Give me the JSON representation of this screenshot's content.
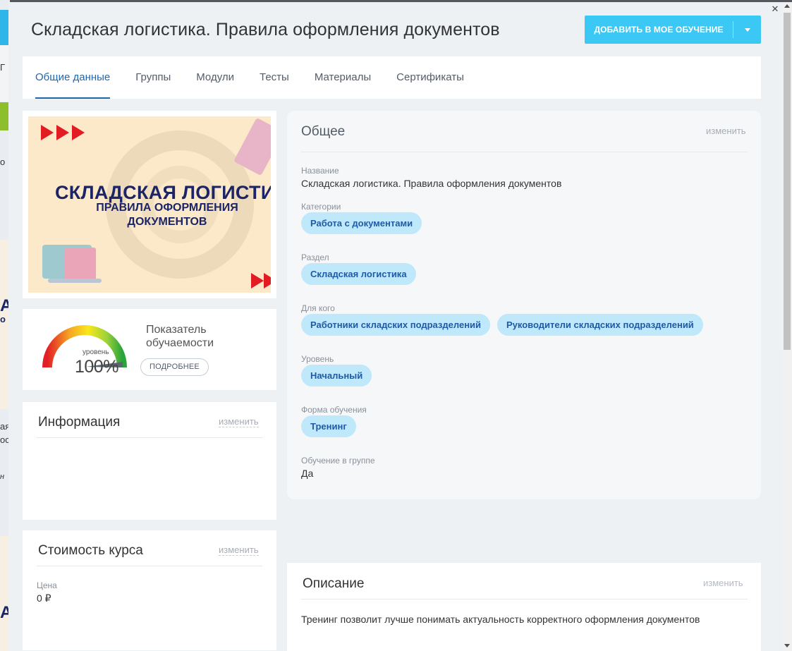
{
  "background": {
    "snippets": [
      "Г",
      "о",
      "А",
      "о",
      "ая",
      "ос",
      "н",
      "А"
    ]
  },
  "header": {
    "title": "Складская логистика. Правила оформления документов",
    "add_button_label": "ДОБАВИТЬ В МОЕ ОБУЧЕНИЕ"
  },
  "tabs": [
    "Общие данные",
    "Группы",
    "Модули",
    "Тесты",
    "Материалы",
    "Сертификаты"
  ],
  "cover": {
    "line1": "СКЛАДСКАЯ ЛОГИСТИКА",
    "line2": "ПРАВИЛА ОФОРМЛЕНИЯ",
    "line3": "ДОКУМЕНТОВ"
  },
  "gauge": {
    "level_label": "уровень",
    "value_text": "100%",
    "value_fraction": 1.0,
    "title": "Показатель обучаемости",
    "details_button": "ПОДРОБНЕЕ"
  },
  "info": {
    "title": "Информация",
    "edit": "изменить"
  },
  "cost": {
    "title": "Стоимость курса",
    "edit": "изменить",
    "price_label": "Цена",
    "price_value": "0 ₽"
  },
  "general": {
    "title": "Общее",
    "edit": "изменить",
    "name_label": "Название",
    "name_value": "Складская логистика. Правила оформления документов",
    "categories_label": "Категории",
    "categories": [
      "Работа с документами"
    ],
    "section_label": "Раздел",
    "section": [
      "Складская логистика"
    ],
    "audience_label": "Для кого",
    "audience": [
      "Работники складских подразделений",
      "Руководители складских подразделений"
    ],
    "level_label": "Уровень",
    "level": [
      "Начальный"
    ],
    "form_label": "Форма обучения",
    "form": [
      "Тренинг"
    ],
    "group_label": "Обучение в группе",
    "group_value": "Да"
  },
  "description": {
    "title": "Описание",
    "edit": "изменить",
    "text": "Тренинг позволит лучше понимать актуальность корректного оформления документов"
  },
  "colors": {
    "accent": "#3bc8f5",
    "tab_active": "#2067b0",
    "chip_bg": "#bfe9fb",
    "chip_text": "#1f5aa6"
  }
}
